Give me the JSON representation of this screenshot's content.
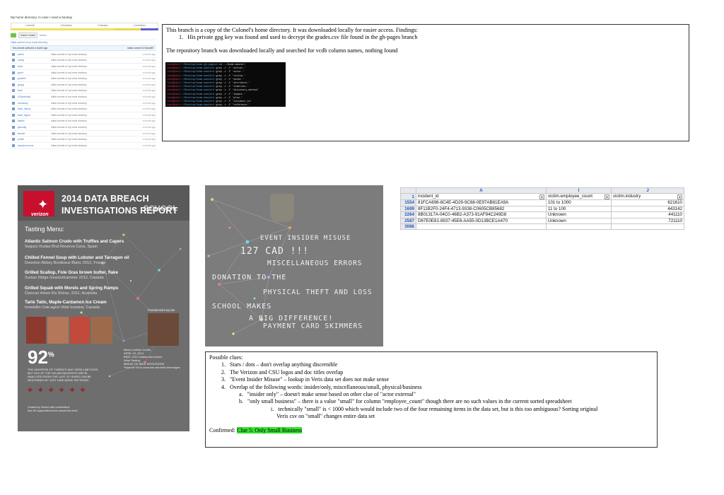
{
  "github": {
    "title": "My home directory. In case I need a backup",
    "stats": [
      "1 commit",
      "2 branches",
      "0 releases",
      "1 contributor"
    ],
    "branch_button": "branch: master",
    "branch_path": "home /",
    "description": "Initial commit of my home directory",
    "commit_author": "the-colonel authored a month ago",
    "commit_latest": "latest commit 137abcd89",
    "files": [
      {
        "name": ".cache",
        "message": "Initial commit of my home directory",
        "age": "a month ago"
      },
      {
        "name": ".config",
        "message": "Initial commit of my home directory",
        "age": "a month ago"
      },
      {
        "name": ".dbus",
        "message": "Initial commit of my home directory",
        "age": "a month ago"
      },
      {
        "name": ".gconf",
        "message": "Initial commit of my home directory",
        "age": "a month ago"
      },
      {
        "name": ".gnome2",
        "message": "Initial commit of my home directory",
        "age": "a month ago"
      },
      {
        "name": ".gnupg",
        "message": "Initial commit of my home directory",
        "age": "a month ago"
      },
      {
        "name": ".local",
        "message": "Initial commit of my home directory",
        "age": "a month ago"
      },
      {
        "name": ".ICEauthority",
        "message": "Initial commit of my home directory",
        "age": "a month ago"
      },
      {
        "name": ".Xauthority",
        "message": "Initial commit of my home directory",
        "age": "a month ago"
      },
      {
        "name": ".bash_history",
        "message": "Initial commit of my home directory",
        "age": "a month ago"
      },
      {
        "name": ".bash_logout",
        "message": "Initial commit of my home directory",
        "age": "a month ago"
      },
      {
        "name": ".bashrc",
        "message": "Initial commit of my home directory",
        "age": "a month ago"
      },
      {
        "name": ".gitconfig",
        "message": "Initial commit of my home directory",
        "age": "a month ago"
      },
      {
        "name": ".lesshst",
        "message": "Initial commit of my home directory",
        "age": "a month ago"
      },
      {
        "name": ".profile",
        "message": "Initial commit of my home directory",
        "age": "a month ago"
      },
      {
        "name": ".xsession-errors",
        "message": "Initial commit of my home directory",
        "age": "a month ago"
      }
    ]
  },
  "notes": {
    "line1": "This branch is a copy of the Colonel's home directory. It was downloaded locally for easier access. Findings:",
    "item1": "1.   His private gpg key was found and used to decrypt the grades.csv file found in the gh-pages branch",
    "line2": "The repository branch was downloaded locally and searched for vcdb column names, nothing found"
  },
  "terminal": {
    "lines": [
      {
        "prompt": "root@kali",
        "path": ":~/Desktop/home-gh-pages#",
        "cmd": " cd ../home-master/"
      },
      {
        "prompt": "root@kali",
        "path": ":~/Desktop/home-master#",
        "cmd": " grep -r -F 'action.'"
      },
      {
        "prompt": "root@kali",
        "path": ":~/Desktop/home-master#",
        "cmd": " grep -r -F 'actor.'"
      },
      {
        "prompt": "root@kali",
        "path": ":~/Desktop/home-master#",
        "cmd": " grep -r -F 'victim.'"
      },
      {
        "prompt": "root@kali",
        "path": ":~/Desktop/home-master#",
        "cmd": " grep -r -F 'asset.'"
      },
      {
        "prompt": "root@kali",
        "path": ":~/Desktop/home-master#",
        "cmd": " grep -r -F 'attribute.'"
      },
      {
        "prompt": "root@kali",
        "path": ":~/Desktop/home-master#",
        "cmd": " grep -r -F 'timeline.'"
      },
      {
        "prompt": "root@kali",
        "path": ":~/Desktop/home-master#",
        "cmd": " grep -r -F 'discovery_method'"
      },
      {
        "prompt": "root@kali",
        "path": ":~/Desktop/home-master#",
        "cmd": " grep -r -F 'impact.'"
      },
      {
        "prompt": "root@kali",
        "path": ":~/Desktop/home-master#",
        "cmd": " grep -r -F 'plus.'"
      },
      {
        "prompt": "root@kali",
        "path": ":~/Desktop/home-master#",
        "cmd": " grep -r -F 'incident_id'"
      },
      {
        "prompt": "root@kali",
        "path": ":~/Desktop/home-master#",
        "cmd": " grep -r -F 'reference.'"
      }
    ]
  },
  "verizon": {
    "logo": "verizon",
    "title1": "2014 DATA BREACH",
    "title_school": "SCHOOL",
    "title2": "INVESTIGATIONS REPORT",
    "menu_heading": "Tasting Menu:",
    "dishes": [
      {
        "name": "Atlantic Salmon Crudo with Truffles and Capers",
        "wine": "Segura Viudas Brut Reserva Cava, Spain"
      },
      {
        "name": "Chilled Fennel Soup with Lobster and Tarragon oil",
        "wine": "Downton Abbey Bordeaux Blanc 2012, France"
      },
      {
        "name": "Grilled Scallop, Fole Gras brown butter, flake",
        "wine": "Sumac Ridge Gewürztraminer 2012, Canada"
      },
      {
        "name": "Grilled Squab with Morels and Spring Ramps",
        "wine": "Clancan Amon Ra Shiraz, 2011, Australia"
      },
      {
        "name": "Tarte Tatin, Maple-Cardamon Ice Cream",
        "wine": "Inniskillin Oak-aged Vidal Icewine, Canada"
      }
    ],
    "percent": "92",
    "percent_sign": "%",
    "percent_text": [
      "THE UNIVERSE OF THREATS MAY SEEM LIMITLESS,",
      "BUT 92% OF THE 100,000 INCIDENTS WE'VE",
      "ANALYZED FROM THE LAST 10 YEARS CAN BE",
      "DESCRIBED BY JUST NINE BASIC PATTERNS."
    ],
    "keynote": "Presidential Keynote",
    "event_info": [
      "Miami Carillon Center",
      "APRIL 23, 2014",
      "BSEL CSU Cadets and Alumni",
      "Wine Tasting",
      "BREAK OF SALE INTRUSIONS",
      "*Must be 19 to consume alcoholic beverages"
    ],
    "curated": [
      "Curated by Verizon with contributions",
      "from 50 organizations from around the world"
    ]
  },
  "school": {
    "lines": [
      "EVENT INSIDER MISUSE",
      "127 CAD !!!",
      "MISCELLANEOUS ERRORS",
      "DONATION TO THE",
      "PHYSICAL THEFT AND LOSS",
      "SCHOOL MAKES",
      "A BIG DIFFERENCE!",
      "PAYMENT CARD SKIMMERS"
    ]
  },
  "spreadsheet": {
    "col_letters": [
      "A",
      "I",
      "J"
    ],
    "header_row_num": "1",
    "headers": [
      "incident_id",
      "victim.employee_count",
      "victim.industry"
    ],
    "rows": [
      {
        "num": "1554",
        "cells": [
          "81FCA696-8C4E-4D29-9C68-0E97AB81EA9A",
          "101 to 1000",
          "621610"
        ]
      },
      {
        "num": "1699",
        "cells": [
          "8F11B2F0-24F4-4713-9338-C0605CB85682",
          "11 to 100",
          "443142"
        ]
      },
      {
        "num": "2264",
        "cells": [
          "8B01317A-04C0-46B2-A373-91AF94C249D8",
          "Unknown",
          "441110"
        ]
      },
      {
        "num": "2587",
        "cells": [
          "D67E0E81-8937-45E6-AA55-0D13BCE1A470",
          "Unknown",
          "721110"
        ]
      },
      {
        "num": "3086",
        "cells": [
          "",
          "",
          ""
        ]
      }
    ]
  },
  "clues": {
    "heading": "Possible clues:",
    "c1": "1.   Stars / dots – don't overlap anything discernible",
    "c2": "2.   The Verizon and CSU logos and doc titles overlap",
    "c3": "3.   \"Event Insider Misuse\" – lookup in Veris data set does not make sense",
    "c4": "4.   Overlap of the following words: insider/only, miscellaneous/small, physical/business",
    "c4a": "a.   \"insider only\" – doesn't make sense based on other clue of \"actor external\"",
    "c4b": "b.   \"only small business\" – there is a value \"small\" for column \"employee_count\" though there are no such values in the current sorted spreadsheet",
    "c4bi": "i.   technically \"small\" is < 1000 which would include two of the four remaining items in the data set, but is this too ambiguous? Sorting original",
    "c4bi2": "Veris csv on \"small\" changes entire data set",
    "confirmed_label": "Confirmed: ",
    "confirmed_value": "Clue 5: Only Small Business"
  }
}
